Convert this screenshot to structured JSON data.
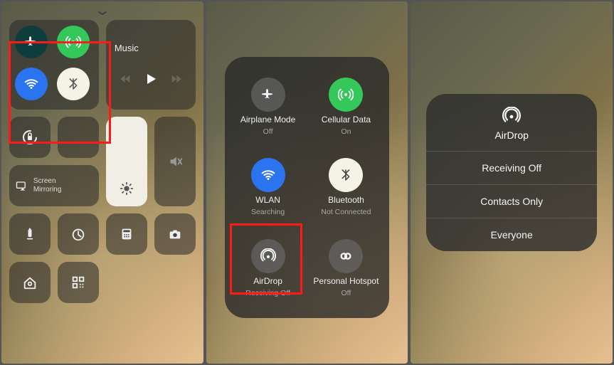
{
  "pane1": {
    "music_label": "Music",
    "screen_mirroring_label": "Screen\nMirroring",
    "toggles": {
      "airplane": {
        "on": false
      },
      "cellular": {
        "on": true
      },
      "wifi": {
        "on": true
      },
      "bluetooth": {
        "on": true
      }
    }
  },
  "pane2": {
    "items": [
      {
        "label": "Airplane Mode",
        "status": "Off",
        "color": "grey",
        "icon": "airplane"
      },
      {
        "label": "Cellular Data",
        "status": "On",
        "color": "green",
        "icon": "cellular"
      },
      {
        "label": "WLAN",
        "status": "Searching",
        "color": "blue",
        "icon": "wifi"
      },
      {
        "label": "Bluetooth",
        "status": "Not Connected",
        "color": "white",
        "icon": "bluetooth"
      },
      {
        "label": "AirDrop",
        "status": "Receiving Off",
        "color": "grey",
        "icon": "airdrop"
      },
      {
        "label": "Personal Hotspot",
        "status": "Off",
        "color": "grey",
        "icon": "hotspot"
      }
    ]
  },
  "pane3": {
    "title": "AirDrop",
    "options": [
      "Receiving Off",
      "Contacts Only",
      "Everyone"
    ]
  }
}
